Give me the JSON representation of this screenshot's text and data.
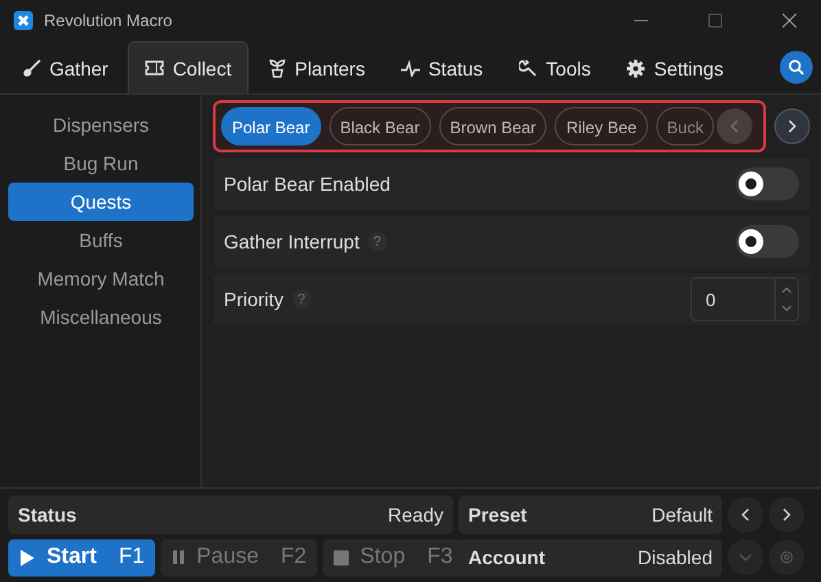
{
  "window": {
    "title": "Revolution Macro"
  },
  "tabs": [
    {
      "label": "Gather",
      "selected": false
    },
    {
      "label": "Collect",
      "selected": true
    },
    {
      "label": "Planters",
      "selected": false
    },
    {
      "label": "Status",
      "selected": false
    },
    {
      "label": "Tools",
      "selected": false
    },
    {
      "label": "Settings",
      "selected": false
    }
  ],
  "sidebar": {
    "items": [
      {
        "label": "Dispensers",
        "selected": false
      },
      {
        "label": "Bug Run",
        "selected": false
      },
      {
        "label": "Quests",
        "selected": true
      },
      {
        "label": "Buffs",
        "selected": false
      },
      {
        "label": "Memory Match",
        "selected": false
      },
      {
        "label": "Miscellaneous",
        "selected": false
      }
    ]
  },
  "quest_tabs": [
    {
      "label": "Polar Bear",
      "selected": true
    },
    {
      "label": "Black Bear",
      "selected": false
    },
    {
      "label": "Brown Bear",
      "selected": false
    },
    {
      "label": "Riley Bee",
      "selected": false
    },
    {
      "label": "Buck",
      "selected": false
    }
  ],
  "settings": [
    {
      "kind": "toggle",
      "label": "Polar Bear Enabled",
      "on": false
    },
    {
      "kind": "toggle",
      "label": "Gather Interrupt",
      "help": "?",
      "on": false
    },
    {
      "kind": "number",
      "label": "Priority",
      "help": "?",
      "value": "0"
    }
  ],
  "status": {
    "label": "Status",
    "value": "Ready"
  },
  "preset": {
    "label": "Preset",
    "value": "Default"
  },
  "controls": [
    {
      "label": "Start",
      "key": "F1",
      "disabled": false
    },
    {
      "label": "Pause",
      "key": "F2",
      "disabled": true
    },
    {
      "label": "Stop",
      "key": "F3",
      "disabled": true
    }
  ],
  "account": {
    "label": "Account",
    "value": "Disabled"
  }
}
